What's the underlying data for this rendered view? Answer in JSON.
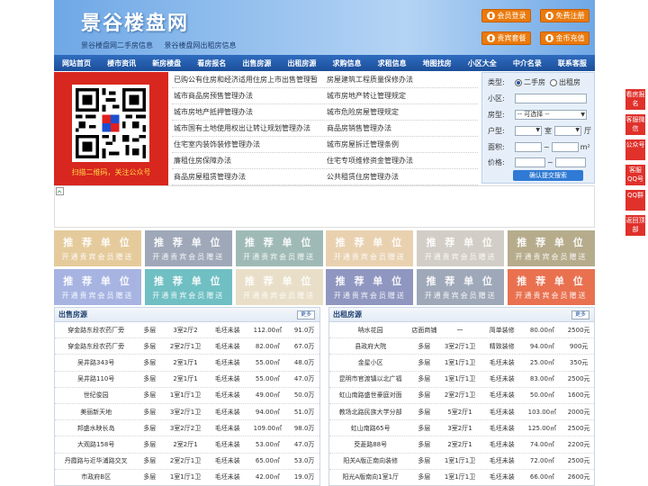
{
  "header": {
    "logo": "景谷楼盘网",
    "sublinks": [
      "景谷楼盘网二手房信息",
      "景谷楼盘网出租房信息"
    ],
    "buttons": [
      "会员登录",
      "免费注册",
      "贵宾套餐",
      "金币充值"
    ]
  },
  "nav": [
    "网站首页",
    "楼市资讯",
    "新房楼盘",
    "看房报名",
    "出售房源",
    "出租房源",
    "求购信息",
    "求租信息",
    "地图找房",
    "小区大全",
    "中介名录",
    "联系客服"
  ],
  "qr_text": "扫描二维码，关注公众号",
  "policy_links": [
    [
      "已购公有住房和经济适用住房上市出售管理暂",
      "房屋建筑工程质量保修办法"
    ],
    [
      "城市商品房预售管理办法",
      "城市房地产转让管理规定"
    ],
    [
      "城市房地产抵押管理办法",
      "城市危险房屋管理规定"
    ],
    [
      "城市国有土地使用权出让转让规划管理办法",
      "商品房销售管理办法"
    ],
    [
      "住宅室内装饰装修管理办法",
      "城市房屋拆迁管理条例"
    ],
    [
      "廉租住房保障办法",
      "住宅专项维修资金管理办法"
    ],
    [
      "商品房屋租赁管理办法",
      "公共租赁住房管理办法"
    ]
  ],
  "search": {
    "type_label": "类型:",
    "type_options": [
      "二手房",
      "出租房"
    ],
    "community_label": "小区:",
    "house_type_label": "房型:",
    "house_type_value": "-- 可选择 --",
    "layout_label": "户型:",
    "room_label": "室",
    "hall_label": "厅",
    "area_label": "面积:",
    "area_unit": "m²",
    "price_label": "价格:",
    "price_sep": "~",
    "submit": "确认提交搜索"
  },
  "ads": {
    "title": "推 荐 单 位",
    "subtitle": "开通贵宾会员赠送",
    "colors": [
      "#e5cb9c",
      "#9fa8b8",
      "#9fbab6",
      "#e9d1b0",
      "#d2cdc6",
      "#b6ac8c",
      "#a7b4e2",
      "#6fbfc3",
      "#e9dfc8",
      "#8f96c0",
      "#9ea8b8",
      "#e97150"
    ]
  },
  "sale": {
    "title": "出售房源",
    "more": "更多",
    "rows": [
      [
        "穿金路东段农药厂旁",
        "多层",
        "3室2厅2",
        "毛坯未装",
        "112.00㎡",
        "91.0万"
      ],
      [
        "穿金路东段农药厂旁",
        "多层",
        "2室2厅1卫",
        "毛坯未装",
        "82.00㎡",
        "67.0万"
      ],
      [
        "吴井路343号",
        "多层",
        "2室1厅1",
        "毛坯未装",
        "55.00㎡",
        "48.0万"
      ],
      [
        "吴井路110号",
        "多层",
        "2室1厅1",
        "毛坯未装",
        "55.00㎡",
        "47.0万"
      ],
      [
        "世纪俊园",
        "多层",
        "1室1厅1卫",
        "毛坯未装",
        "49.00㎡",
        "50.0万"
      ],
      [
        "美丽新天地",
        "多层",
        "3室2厅1卫",
        "毛坯未装",
        "94.00㎡",
        "51.0万"
      ],
      [
        "邦盛水映长岛",
        "多层",
        "3室2厅2卫",
        "毛坯未装",
        "109.00㎡",
        "98.0万"
      ],
      [
        "大观路158号",
        "多层",
        "2室2厅1",
        "毛坯未装",
        "53.00㎡",
        "47.0万"
      ],
      [
        "丹霞路与近华浦路交叉",
        "多层",
        "2室2厅1卫",
        "毛坯未装",
        "65.00㎡",
        "53.0万"
      ],
      [
        "市政府B区",
        "多层",
        "1室1厅1卫",
        "毛坯未装",
        "42.00㎡",
        "19.0万"
      ]
    ]
  },
  "rent": {
    "title": "出租房源",
    "more": "更多",
    "rows": [
      [
        "呐水花园",
        "店面商铺",
        "一",
        "简单装修",
        "80.00㎡",
        "2500元"
      ],
      [
        "县政府大院",
        "多层",
        "3室2厅1卫",
        "精致装修",
        "94.00㎡",
        "900元"
      ],
      [
        "金星小区",
        "多层",
        "1室1厅1卫",
        "毛坯未装",
        "25.00㎡",
        "350元"
      ],
      [
        "昆明市官渡镇以北广福",
        "多层",
        "1室1厅1卫",
        "毛坯未装",
        "83.00㎡",
        "2500元"
      ],
      [
        "虹山南路盛世豪庭对面",
        "多层",
        "2室2厅1卫",
        "毛坯未装",
        "50.00㎡",
        "1600元"
      ],
      [
        "教场北路民族大学分部",
        "多层",
        "5室2厅1",
        "毛坯未装",
        "103.00㎡",
        "2000元"
      ],
      [
        "虹山南路65号",
        "多层",
        "3室2厅1",
        "毛坯未装",
        "125.00㎡",
        "2500元"
      ],
      [
        "茭菱路88号",
        "多层",
        "2室2厅1",
        "毛坯未装",
        "74.00㎡",
        "2200元"
      ],
      [
        "阳关A版正南向装修",
        "多层",
        "1室1厅1卫",
        "毛坯未装",
        "72.00㎡",
        "2500元"
      ],
      [
        "阳光A版南向1室1厅",
        "多层",
        "1室1厅1卫",
        "毛坯未装",
        "66.00㎡",
        "2600元"
      ]
    ]
  },
  "sidebar": [
    "看房报名",
    "客服微信",
    "公众号",
    "客服QQ号",
    "QQ群",
    "返回顶部"
  ]
}
